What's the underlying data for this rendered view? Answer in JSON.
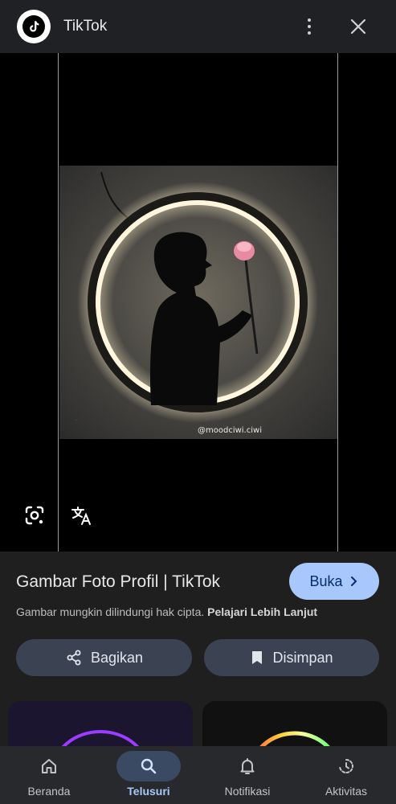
{
  "header": {
    "app_name": "TikTok",
    "logo_icon": "tiktok-logo-icon",
    "more_icon": "more-vert-icon",
    "close_icon": "close-icon"
  },
  "viewer": {
    "watermark": "@moodciwi.ciwi",
    "lens_icon": "google-lens-icon",
    "translate_icon": "translate-icon"
  },
  "result": {
    "title": "Gambar Foto Profil | TikTok",
    "visit_label": "Buka",
    "copyright_text": "Gambar mungkin dilindungi hak cipta.",
    "learn_more": "Pelajari Lebih Lanjut",
    "share_label": "Bagikan",
    "save_label": "Disimpan"
  },
  "colors": {
    "accent": "#a8c7fa",
    "pill_bg": "#3b4252",
    "background": "#1f1f1f"
  },
  "bottom_nav": {
    "items": [
      {
        "label": "Beranda",
        "icon": "home-icon",
        "active": false
      },
      {
        "label": "Telusuri",
        "icon": "search-icon",
        "active": true
      },
      {
        "label": "Notifikasi",
        "icon": "bell-icon",
        "active": false
      },
      {
        "label": "Aktivitas",
        "icon": "activity-icon",
        "active": false
      }
    ]
  }
}
